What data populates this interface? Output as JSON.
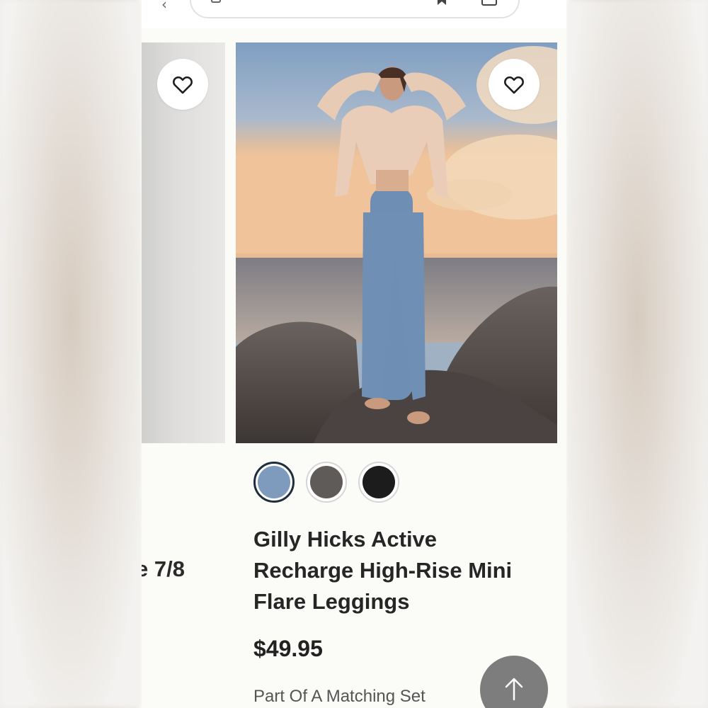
{
  "left_card": {
    "title_fragment": "e 7/8"
  },
  "product": {
    "title_line1": "Gilly Hicks Active",
    "title_line2": "Recharge High-Rise Mini",
    "title_line3": "Flare Leggings",
    "price": "$49.95",
    "note": "Part Of A Matching Set"
  },
  "swatches": [
    {
      "color": "#7e9bbd",
      "selected": true
    },
    {
      "color": "#5f5b59",
      "selected": false
    },
    {
      "color": "#1c1c1c",
      "selected": false
    }
  ],
  "icons": {
    "wishlist": "heart-outline-icon",
    "scroll_top": "arrow-up-icon",
    "bookmark": "bookmark-icon",
    "tabs": "tab-switcher-icon"
  }
}
